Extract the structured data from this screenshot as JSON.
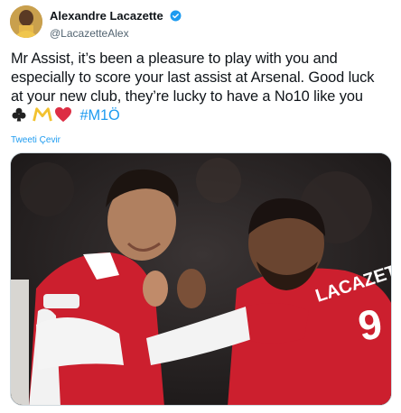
{
  "author": {
    "display_name": "Alexandre Lacazette",
    "handle": "@LacazetteAlex",
    "verified_icon": "verified-badge-icon"
  },
  "tweet": {
    "lines": [
      "Mr Assist, it’s been a pleasure to play with you and",
      "especially to score your last assist at Arsenal. Good luck",
      "at your new club, they’re lucky to have a No10 like you"
    ],
    "emojis": [
      "club-suit-icon",
      "m-logo-icon",
      "red-heart-icon"
    ],
    "hashtag": "#M1Ö",
    "translate_label": "Tweeti Çevir"
  },
  "photo": {
    "description_icon": "tweet-photo",
    "shirt_text": "LACAZET",
    "shirt_number": "9"
  },
  "colors": {
    "link": "#1d9bf0",
    "text": "#0f1419",
    "muted": "#536471",
    "arsenal_red": "#c8102e"
  }
}
